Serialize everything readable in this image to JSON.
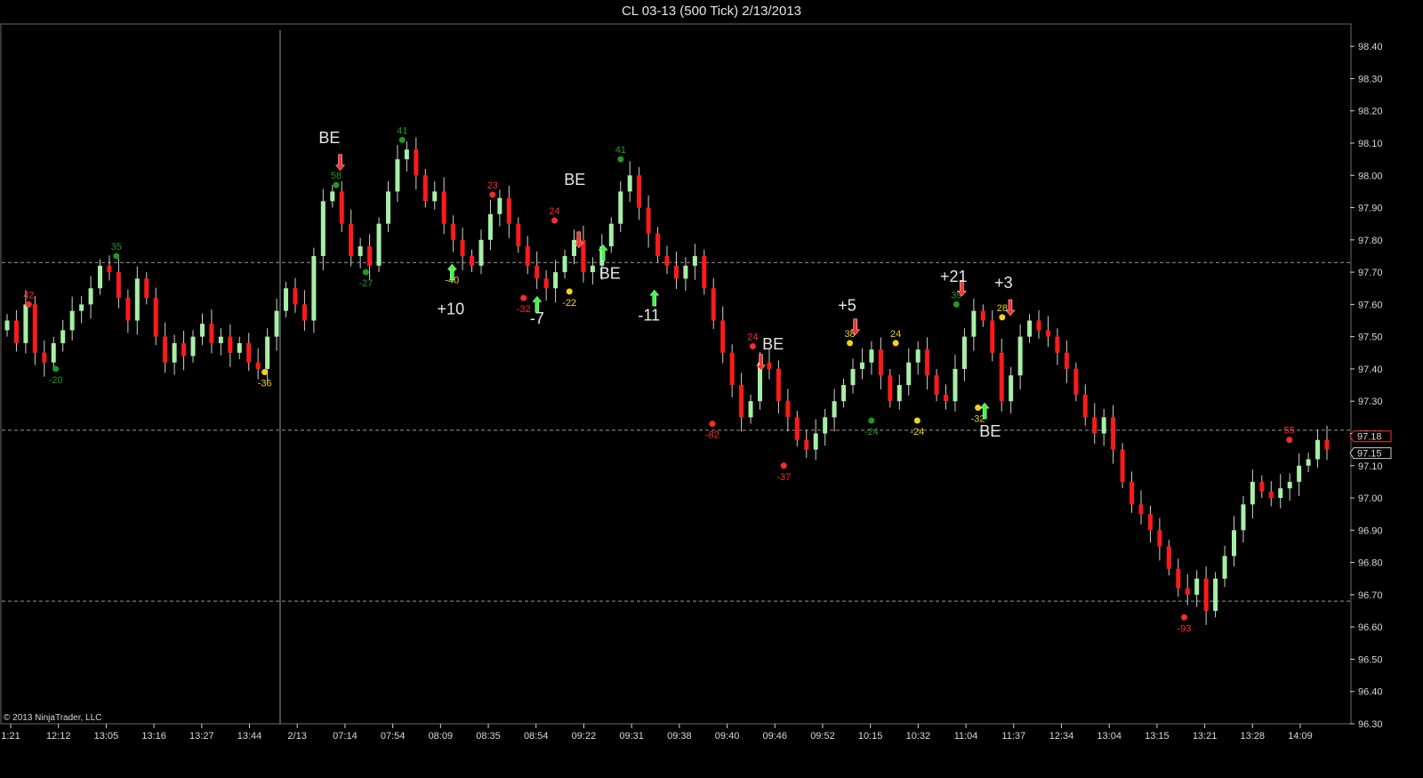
{
  "window": {
    "title": "CL 03-13 (500 Tick)  2/13/2013"
  },
  "copyright": "© 2013 NinjaTrader, LLC",
  "colors": {
    "up": "#a6f0a6",
    "down": "#ff1a1a",
    "wick": "#cfcfcf",
    "grid": "#9a9a9a",
    "swing_high_red": "#ff2a2a",
    "swing_green": "#1f9a1f",
    "swing_yellow": "#f2d21c",
    "arrow_up": "#39ff39",
    "arrow_down": "#ff3030",
    "note": "#e8e8e8"
  },
  "chart_data": {
    "type": "candlestick",
    "instrument": "CL 03-13",
    "bar_type": "500 Tick",
    "date": "2/13/2013",
    "ylim": [
      96.3,
      98.45
    ],
    "y_ticks": [
      "98.40",
      "98.30",
      "98.20",
      "98.10",
      "98.00",
      "97.90",
      "97.80",
      "97.70",
      "97.60",
      "97.50",
      "97.40",
      "97.30",
      "97.20",
      "97.10",
      "97.00",
      "96.90",
      "96.80",
      "96.70",
      "96.60",
      "96.50",
      "96.40",
      "96.30"
    ],
    "x_ticks": [
      "1:21",
      "12:12",
      "13:05",
      "13:16",
      "13:27",
      "13:44",
      "2/13",
      "07:14",
      "07:54",
      "08:09",
      "08:35",
      "08:54",
      "09:22",
      "09:31",
      "09:38",
      "09:40",
      "09:46",
      "09:52",
      "10:15",
      "10:32",
      "11:04",
      "11:37",
      "12:34",
      "13:04",
      "13:15",
      "13:21",
      "13:28",
      "14:09"
    ],
    "price_markers": [
      {
        "label": "97.18"
      },
      {
        "label": "97.15"
      }
    ],
    "horizontal_lines": [
      97.73,
      97.21,
      96.68
    ],
    "session_break_label": "2/13",
    "close_path": [
      97.55,
      97.48,
      97.6,
      97.45,
      97.42,
      97.48,
      97.52,
      97.58,
      97.6,
      97.65,
      97.72,
      97.7,
      97.62,
      97.55,
      97.68,
      97.62,
      97.5,
      97.42,
      97.48,
      97.44,
      97.5,
      97.54,
      97.48,
      97.5,
      97.45,
      97.48,
      97.42,
      97.4,
      97.5,
      97.58,
      97.65,
      97.6,
      97.55,
      97.75,
      97.92,
      97.95,
      97.85,
      97.75,
      97.78,
      97.72,
      97.85,
      97.95,
      98.05,
      98.08,
      98.0,
      97.92,
      97.95,
      97.85,
      97.8,
      97.75,
      97.72,
      97.8,
      97.88,
      97.93,
      97.85,
      97.78,
      97.72,
      97.68,
      97.65,
      97.7,
      97.75,
      97.8,
      97.7,
      97.72,
      97.78,
      97.85,
      97.95,
      98.0,
      97.9,
      97.82,
      97.75,
      97.72,
      97.68,
      97.72,
      97.75,
      97.65,
      97.55,
      97.45,
      97.35,
      97.25,
      97.3,
      97.42,
      97.4,
      97.3,
      97.25,
      97.18,
      97.15,
      97.2,
      97.25,
      97.3,
      97.35,
      97.4,
      97.42,
      97.46,
      97.38,
      97.3,
      97.35,
      97.42,
      97.46,
      97.38,
      97.32,
      97.3,
      97.4,
      97.5,
      97.58,
      97.55,
      97.45,
      97.3,
      97.38,
      97.5,
      97.55,
      97.52,
      97.5,
      97.45,
      97.4,
      97.32,
      97.25,
      97.2,
      97.25,
      97.15,
      97.05,
      96.98,
      96.95,
      96.9,
      96.85,
      96.78,
      96.72,
      96.7,
      96.75,
      96.65,
      96.75,
      96.82,
      96.9,
      96.98,
      97.05,
      97.02,
      97.0,
      97.03,
      97.05,
      97.1,
      97.12,
      97.18,
      97.15
    ],
    "swing_points": [
      {
        "label": "42",
        "color": "red",
        "price": 97.6,
        "x_frac": 0.02
      },
      {
        "label": "-20",
        "color": "green",
        "price": 97.4,
        "x_frac": 0.04
      },
      {
        "label": "35",
        "color": "green",
        "price": 97.75,
        "x_frac": 0.085
      },
      {
        "label": "-36",
        "color": "yellow",
        "price": 97.39,
        "x_frac": 0.195
      },
      {
        "label": "58",
        "color": "green",
        "price": 97.97,
        "x_frac": 0.248
      },
      {
        "label": "-27",
        "color": "green",
        "price": 97.7,
        "x_frac": 0.27
      },
      {
        "label": "41",
        "color": "green",
        "price": 98.11,
        "x_frac": 0.297
      },
      {
        "label": "-40",
        "color": "yellow",
        "price": 97.71,
        "x_frac": 0.334
      },
      {
        "label": "23",
        "color": "red",
        "price": 97.94,
        "x_frac": 0.364
      },
      {
        "label": "-32",
        "color": "red",
        "price": 97.62,
        "x_frac": 0.387
      },
      {
        "label": "24",
        "color": "red",
        "price": 97.86,
        "x_frac": 0.41
      },
      {
        "label": "-22",
        "color": "yellow",
        "price": 97.64,
        "x_frac": 0.421
      },
      {
        "label": "41",
        "color": "green",
        "price": 98.05,
        "x_frac": 0.459
      },
      {
        "label": "-82",
        "color": "red",
        "price": 97.23,
        "x_frac": 0.527
      },
      {
        "label": "24",
        "color": "red",
        "price": 97.47,
        "x_frac": 0.557
      },
      {
        "label": "-37",
        "color": "red",
        "price": 97.1,
        "x_frac": 0.58
      },
      {
        "label": "38",
        "color": "yellow",
        "price": 97.48,
        "x_frac": 0.629
      },
      {
        "label": "-24",
        "color": "green",
        "price": 97.24,
        "x_frac": 0.645
      },
      {
        "label": "24",
        "color": "yellow",
        "price": 97.48,
        "x_frac": 0.663
      },
      {
        "label": "-24",
        "color": "yellow",
        "price": 97.24,
        "x_frac": 0.679
      },
      {
        "label": "39",
        "color": "green",
        "price": 97.6,
        "x_frac": 0.708
      },
      {
        "label": "-32",
        "color": "yellow",
        "price": 97.28,
        "x_frac": 0.724
      },
      {
        "label": "28",
        "color": "yellow",
        "price": 97.56,
        "x_frac": 0.742
      },
      {
        "label": "-93",
        "color": "red",
        "price": 96.63,
        "x_frac": 0.877
      },
      {
        "label": "55",
        "color": "red",
        "price": 97.18,
        "x_frac": 0.955
      }
    ],
    "trade_annotations": [
      {
        "text": "BE",
        "price": 98.1,
        "x_frac": 0.243
      },
      {
        "text": "+10",
        "price": 97.57,
        "x_frac": 0.333
      },
      {
        "text": "-7",
        "price": 97.54,
        "x_frac": 0.397
      },
      {
        "text": "BE",
        "price": 97.97,
        "x_frac": 0.425
      },
      {
        "text": "BE",
        "price": 97.68,
        "x_frac": 0.451
      },
      {
        "text": "-11",
        "price": 97.55,
        "x_frac": 0.48
      },
      {
        "text": "BE",
        "price": 97.46,
        "x_frac": 0.572
      },
      {
        "text": "+5",
        "price": 97.58,
        "x_frac": 0.627
      },
      {
        "text": "+21",
        "price": 97.67,
        "x_frac": 0.706
      },
      {
        "text": "+3",
        "price": 97.65,
        "x_frac": 0.743
      },
      {
        "text": "BE",
        "price": 97.19,
        "x_frac": 0.733
      }
    ],
    "entry_arrows": [
      {
        "dir": "down",
        "price": 98.04,
        "x_frac": 0.251
      },
      {
        "dir": "up",
        "price": 97.7,
        "x_frac": 0.334
      },
      {
        "dir": "up",
        "price": 97.6,
        "x_frac": 0.397
      },
      {
        "dir": "down",
        "price": 97.8,
        "x_frac": 0.428
      },
      {
        "dir": "up",
        "price": 97.76,
        "x_frac": 0.446
      },
      {
        "dir": "up",
        "price": 97.62,
        "x_frac": 0.484
      },
      {
        "dir": "down",
        "price": 97.42,
        "x_frac": 0.563
      },
      {
        "dir": "down",
        "price": 97.53,
        "x_frac": 0.633
      },
      {
        "dir": "down",
        "price": 97.65,
        "x_frac": 0.712
      },
      {
        "dir": "up",
        "price": 97.27,
        "x_frac": 0.729
      },
      {
        "dir": "down",
        "price": 97.59,
        "x_frac": 0.748
      }
    ]
  }
}
